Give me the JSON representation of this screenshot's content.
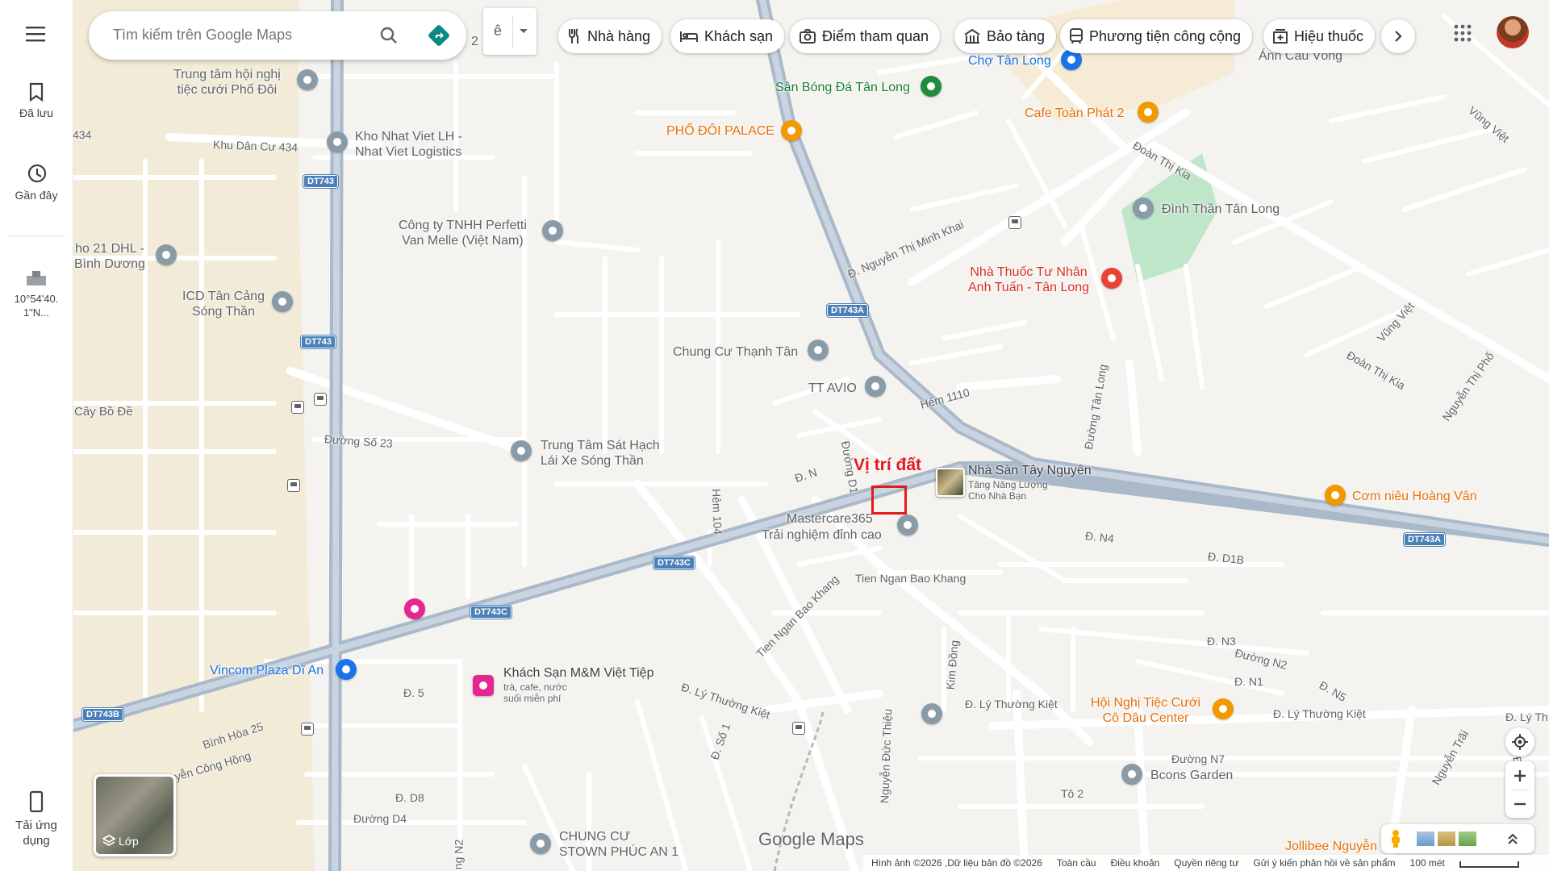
{
  "sidebar": {
    "menu_icon": "menu-icon",
    "saved_label": "Đã lưu",
    "recent_label": "Gần đây",
    "coords_label": "10°54'40.\n1\"N...",
    "app_label": "Tải ứng\ndụng"
  },
  "search": {
    "placeholder": "Tìm kiếm trên Google Maps",
    "partial_label": "2",
    "lang_label": "ê"
  },
  "chips": [
    {
      "label": "Nhà hàng",
      "icon": "restaurant-icon"
    },
    {
      "label": "Khách sạn",
      "icon": "hotel-icon"
    },
    {
      "label": "Điểm tham quan",
      "icon": "camera-icon"
    },
    {
      "label": "Bảo tàng",
      "icon": "museum-icon"
    },
    {
      "label": "Phương tiện công cộng",
      "icon": "transit-icon"
    },
    {
      "label": "Hiệu thuốc",
      "icon": "pharmacy-icon"
    }
  ],
  "marker": {
    "label": "Vị trí đất",
    "color": "#e31a1c"
  },
  "places": [
    {
      "name": "Trung tâm hội nghị\ntiệc cưới Phố Đôi",
      "type": "grey"
    },
    {
      "name": "Kho Nhat Viet LH -\nNhat Viet Logistics",
      "type": "grey"
    },
    {
      "name": "Công ty TNHH Perfetti\nVan Melle (Việt Nam)",
      "type": "grey"
    },
    {
      "name": "ho 21 DHL -\nBình Dương",
      "type": "grey"
    },
    {
      "name": "ICD Tân Cảng\nSóng Thần",
      "type": "grey"
    },
    {
      "name": "Chợ Tân Long",
      "type": "blue"
    },
    {
      "name": "Sân Bóng Đá Tân Long",
      "type": "green"
    },
    {
      "name": "PHỐ ĐÔI PALACE",
      "type": "orange"
    },
    {
      "name": "Cafe Toàn Phát 2",
      "type": "orange"
    },
    {
      "name": "Đình Thần Tân Long",
      "type": "grey"
    },
    {
      "name": "Nhà Thuốc Tư Nhân\nAnh Tuấn - Tân Long",
      "type": "red"
    },
    {
      "name": "Chung Cư Thạnh Tân",
      "type": "grey"
    },
    {
      "name": "TT AVIO",
      "type": "grey"
    },
    {
      "name": "Trung Tâm Sát Hạch\nLái Xe Sóng Thần",
      "type": "grey"
    },
    {
      "name": "Nhà Sàn Tây Nguyên",
      "type": "photo",
      "sub": "Tăng Năng Lượng\nCho Nhà Bạn"
    },
    {
      "name": "Mastercare365",
      "type": "grey",
      "sub": "Trải nghiệm đỉnh cao"
    },
    {
      "name": "Cơm niêu Hoàng Vân",
      "type": "orange"
    },
    {
      "name": "Vincom Plaza Dĩ An",
      "type": "blue"
    },
    {
      "name": "Khách Sạn M&M Việt Tiệp",
      "type": "pink",
      "sub": "trà, cafe, nước\nsuối miễn phí"
    },
    {
      "name": "Hội Nghị Tiệc Cưới\nCô Dâu Center",
      "type": "orange"
    },
    {
      "name": "Bcons Garden",
      "type": "grey"
    },
    {
      "name": "CHUNG CƯ\nSTOWN PHÚC AN 1",
      "type": "grey"
    },
    {
      "name": "Jollibee Nguyễn",
      "type": "orange"
    },
    {
      "name": "Ánh Câu Vòng",
      "type": "grey"
    }
  ],
  "streets": [
    "Khu Dân Cư 434",
    "434",
    "Đường Số 23",
    "Cây Bồ Đề",
    "Đ. Nguyễn Thị Minh Khai",
    "Đoàn Thị Kia",
    "Đoàn Thị Kia",
    "Vũng Việt",
    "Vũng Việt",
    "Nguyễn Thị Phố",
    "Đường Tân Long",
    "Hẻm 1110",
    "Hẻm 104",
    "Đường D1",
    "Đ. N",
    "Đ. N4",
    "Đ. D1B",
    "Tien Ngan Bao Khang",
    "Tien Ngan Bao Khang",
    "Đ. Lý Thường Kiệt",
    "Đ. Lý Thường Kiệt",
    "Đ. Lý Thường Kiệt",
    "Đ. Lý Th",
    "Đ. N3",
    "Đường N2",
    "Đ. N1",
    "Đ. N5",
    "Kim Đồng",
    "Đường N7",
    "Tô 2",
    "Đ. Số 1",
    "Nguyễn Đức Thiệu",
    "Bình Hòa 25",
    "guyễn Công Hồng",
    "Đ. D8",
    "Đường D4",
    "Đ. 5",
    "ng N2",
    "Nguyễn Trãi",
    "Đ. Lý"
  ],
  "shields": [
    "DT743",
    "DT743",
    "DT743A",
    "DT743A",
    "DT743C",
    "DT743C",
    "DT743B"
  ],
  "layers": {
    "label": "Lớp"
  },
  "brand": "Google Maps",
  "footer": [
    "Hình ảnh ©2026 ,Dữ liệu bản đồ ©2026",
    "Toàn cầu",
    "Điều khoản",
    "Quyền riêng tư",
    "Gửi ý kiến phản hồi về sản phẩm",
    "100 mét"
  ],
  "colors": {
    "road_major": "#aab9c9",
    "road_minor": "#ffffff",
    "land": "#f5f3ef",
    "industrial": "#f2ebd8",
    "park": "#bfe6c9"
  }
}
